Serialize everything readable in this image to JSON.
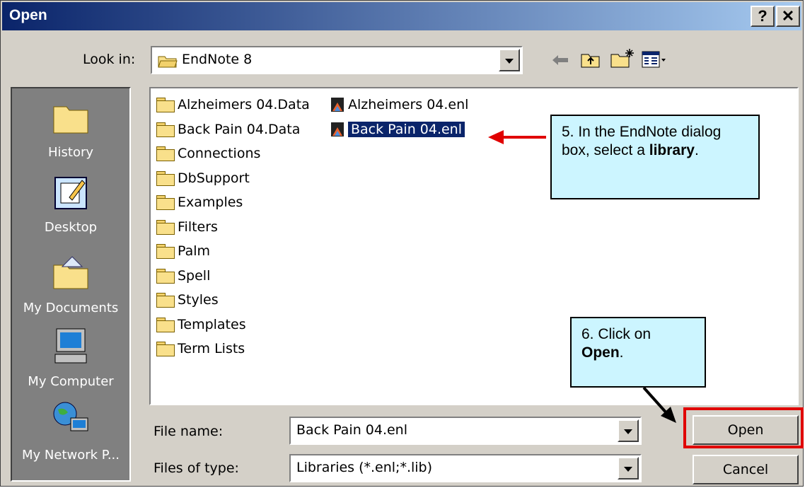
{
  "window": {
    "title": "Open",
    "help_label": "?",
    "close_label": "✕"
  },
  "lookin": {
    "label": "Look in:",
    "value": "EndNote 8"
  },
  "places": [
    {
      "label": "History",
      "icon": "history-folder-icon"
    },
    {
      "label": "Desktop",
      "icon": "desktop-icon"
    },
    {
      "label": "My Documents",
      "icon": "my-documents-icon"
    },
    {
      "label": "My Computer",
      "icon": "my-computer-icon"
    },
    {
      "label": "My Network P...",
      "icon": "my-network-places-icon"
    }
  ],
  "folders": [
    "Alzheimers 04.Data",
    "Back Pain 04.Data",
    "Connections",
    "DbSupport",
    "Examples",
    "Filters",
    "Palm",
    "Spell",
    "Styles",
    "Templates",
    "Term Lists"
  ],
  "files": [
    {
      "name": "Alzheimers 04.enl",
      "selected": false
    },
    {
      "name": "Back Pain 04.enl",
      "selected": true
    }
  ],
  "filename": {
    "label": "File name:",
    "value": "Back Pain 04.enl"
  },
  "filetype": {
    "label": "Files of type:",
    "value": "Libraries (*.enl;*.lib)"
  },
  "buttons": {
    "open": "Open",
    "cancel": "Cancel"
  },
  "callouts": {
    "library": {
      "pre": "5. In the EndNote dialog box, select a ",
      "bold": "library",
      "post": "."
    },
    "open": {
      "pre": "6. Click on ",
      "bold": "Open",
      "post": "."
    }
  },
  "colors": {
    "selection": "#0a246a",
    "callout_bg": "#ccf5ff",
    "highlight": "#e00000",
    "arrow": "#e00000"
  }
}
